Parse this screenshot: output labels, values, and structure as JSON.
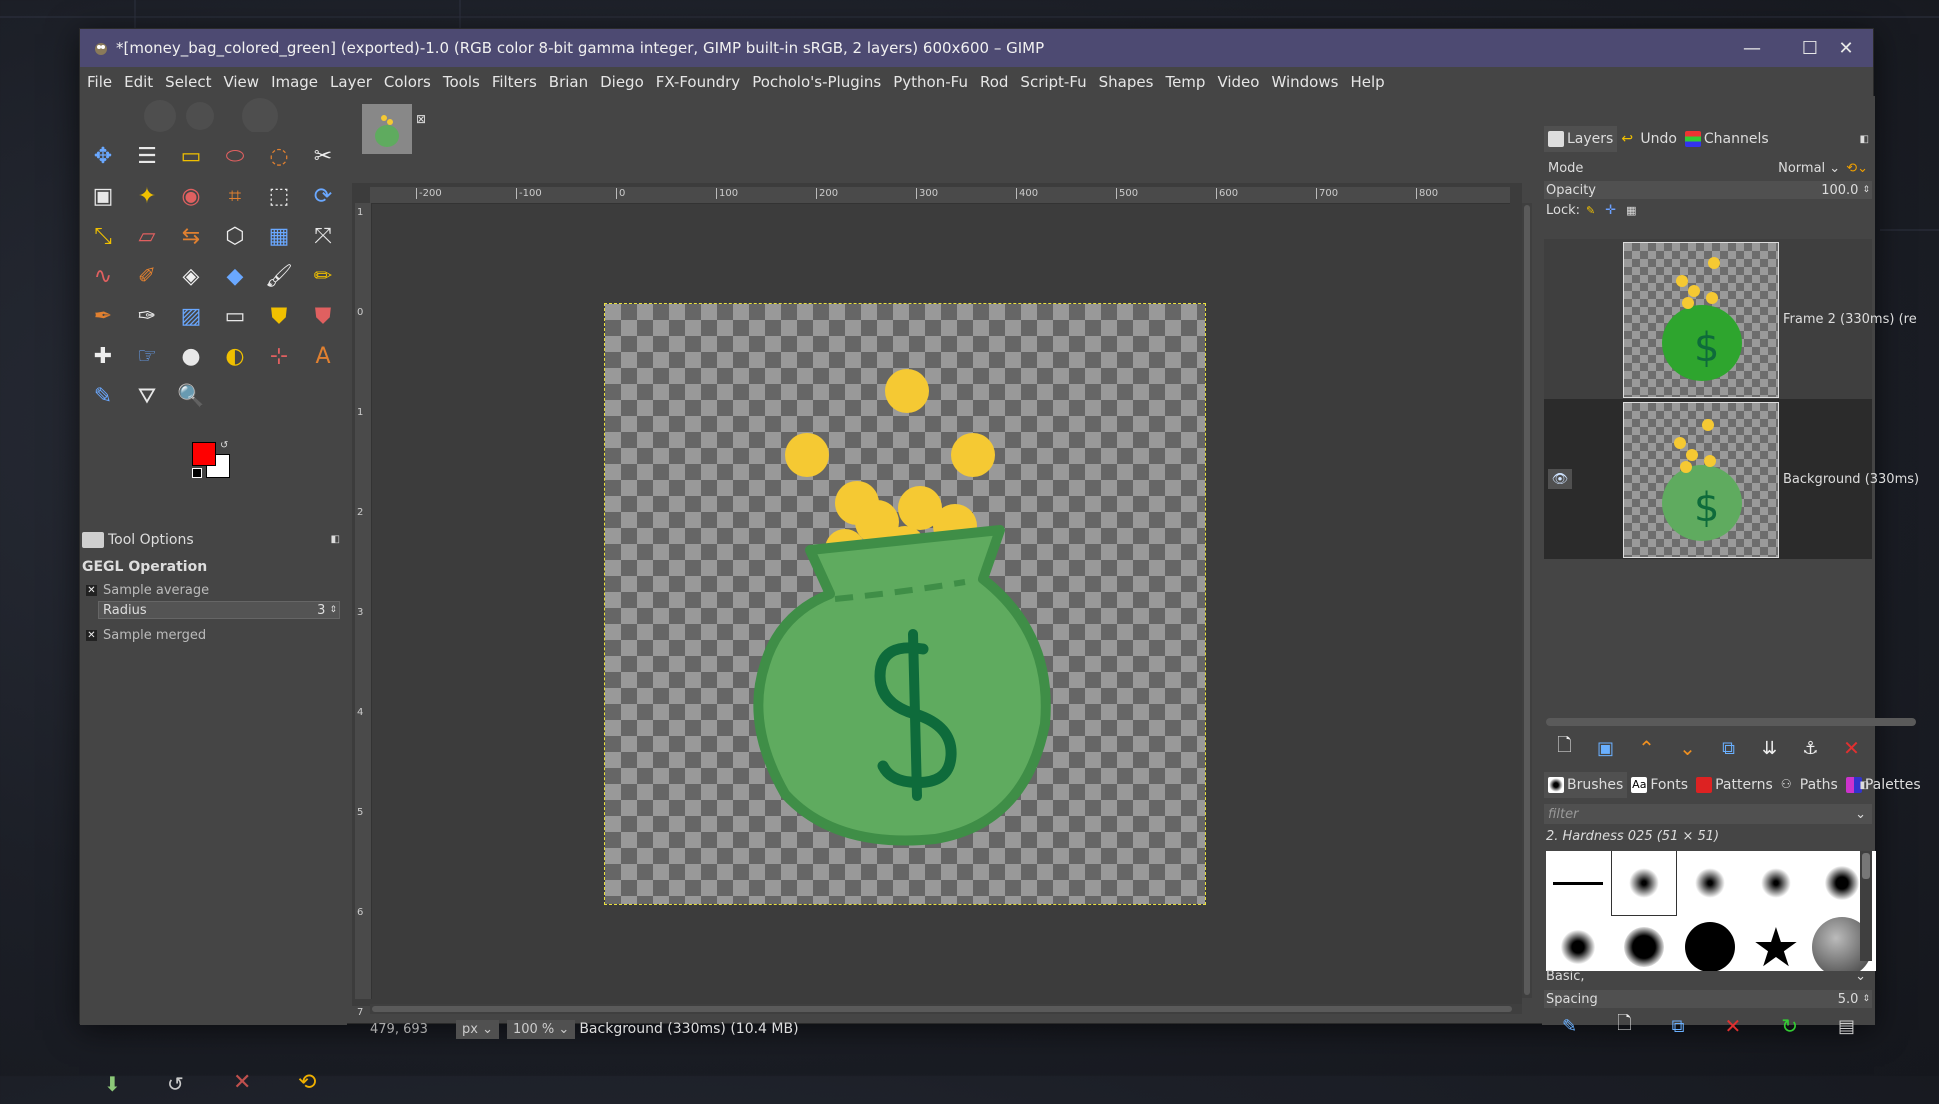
{
  "window": {
    "title": "*[money_bag_colored_green] (exported)-1.0 (RGB color 8-bit gamma integer, GIMP built-in sRGB, 2 layers) 600x600 – GIMP",
    "controls": {
      "minimize": "—",
      "maximize": "☐",
      "close": "✕"
    }
  },
  "menu": [
    "File",
    "Edit",
    "Select",
    "View",
    "Image",
    "Layer",
    "Colors",
    "Tools",
    "Filters",
    "Brian",
    "Diego",
    "FX-Foundry",
    "Pocholo's-Plugins",
    "Python-Fu",
    "Rod",
    "Script-Fu",
    "Shapes",
    "Temp",
    "Video",
    "Windows",
    "Help"
  ],
  "colors": {
    "foreground": "#ff0000",
    "background": "#ffffff",
    "bag_fill": "#5fab5f",
    "bag_outline": "#3f8e47",
    "dollar": "#0e6b3b",
    "coin": "#f5c933",
    "titlebar": "#4d4a72"
  },
  "tool_options": {
    "tab_label": "Tool Options",
    "section": "GEGL Operation",
    "sample_average": "Sample average",
    "radius_label": "Radius",
    "radius_value": "3",
    "sample_merged": "Sample merged"
  },
  "ruler": {
    "h_labels": [
      "-200",
      "-100",
      "0",
      "100",
      "200",
      "300",
      "400",
      "500",
      "600",
      "700",
      "800"
    ],
    "v_labels": [
      "1",
      "0",
      "1",
      "2",
      "3",
      "4",
      "5",
      "6",
      "7"
    ]
  },
  "status": {
    "coords": "479, 693",
    "unit": "px",
    "zoom": "100 %",
    "info": "Background (330ms) (10.4 MB)"
  },
  "dock": {
    "tabs": [
      "Layers",
      "Undo",
      "Channels"
    ],
    "mode_label": "Mode",
    "mode_value": "Normal",
    "opacity_label": "Opacity",
    "opacity_value": "100.0",
    "lock_label": "Lock:",
    "layers": [
      {
        "name": "Frame 2 (330ms) (re",
        "visible": false
      },
      {
        "name": "Background (330ms)",
        "visible": true
      }
    ],
    "brush_tabs": [
      "Brushes",
      "Fonts",
      "Patterns",
      "Paths",
      "Palettes"
    ],
    "filter_placeholder": "filter",
    "brush_name": "2. Hardness 025 (51 × 51)",
    "brush_tag": "Basic,",
    "spacing_label": "Spacing",
    "spacing_value": "5.0"
  }
}
